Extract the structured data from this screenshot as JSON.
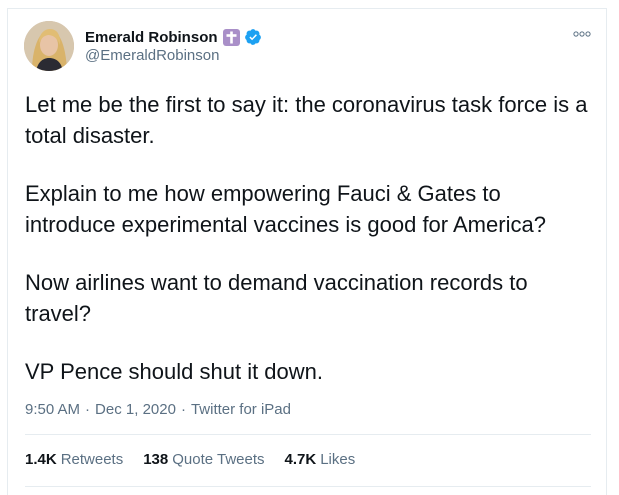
{
  "tweet": {
    "display_name": "Emerald Robinson",
    "handle": "@EmeraldRobinson",
    "badges": [
      "cross-icon",
      "verified-icon"
    ],
    "paragraphs": [
      "Let me be the first to say it: the coronavirus task force is a total disaster.",
      "Explain to me how empowering Fauci & Gates to introduce experimental vaccines is good for America?",
      "Now airlines want to demand vaccination records to travel?",
      "VP Pence should shut it down."
    ],
    "time": "9:50 AM",
    "date": "Dec 1, 2020",
    "source": "Twitter for iPad",
    "separator": "·"
  },
  "stats": {
    "retweets_count": "1.4K",
    "retweets_label": "Retweets",
    "quotes_count": "138",
    "quotes_label": "Quote Tweets",
    "likes_count": "4.7K",
    "likes_label": "Likes"
  },
  "colors": {
    "text": "#0f1419",
    "secondary": "#5b7083",
    "border": "#e6ecf0",
    "verified": "#1da1f2",
    "cross_badge": "#a98fc8"
  }
}
